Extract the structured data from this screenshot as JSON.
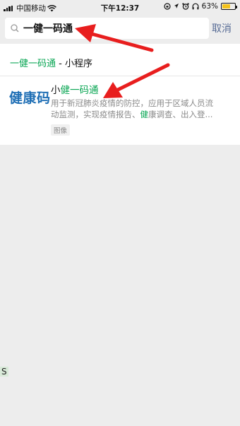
{
  "status_bar": {
    "carrier": "中国移动",
    "time": "下午12:37",
    "battery": "63%",
    "battery_level": 0.63
  },
  "search": {
    "query": "一健一码通",
    "cancel_label": "取消"
  },
  "results": {
    "category": {
      "query_highlight": "一健一码通",
      "suffix": " - 小程序"
    },
    "item": {
      "logo_text": "健康码",
      "name_prefix": "小",
      "name_highlight": "健一码通",
      "desc_line1": "用于新冠肺炎疫情的防控，应用于区域人员流",
      "desc_line2_a": "动监测，实现疫情报告、",
      "desc_line2_hl": "健",
      "desc_line2_b": "康调查、出入登...",
      "tag": "图像"
    }
  },
  "side_mark": "S",
  "colors": {
    "highlight": "#07a552",
    "link": "#576b95",
    "arrow": "#e81e1e",
    "logo": "#1f6fb5"
  }
}
